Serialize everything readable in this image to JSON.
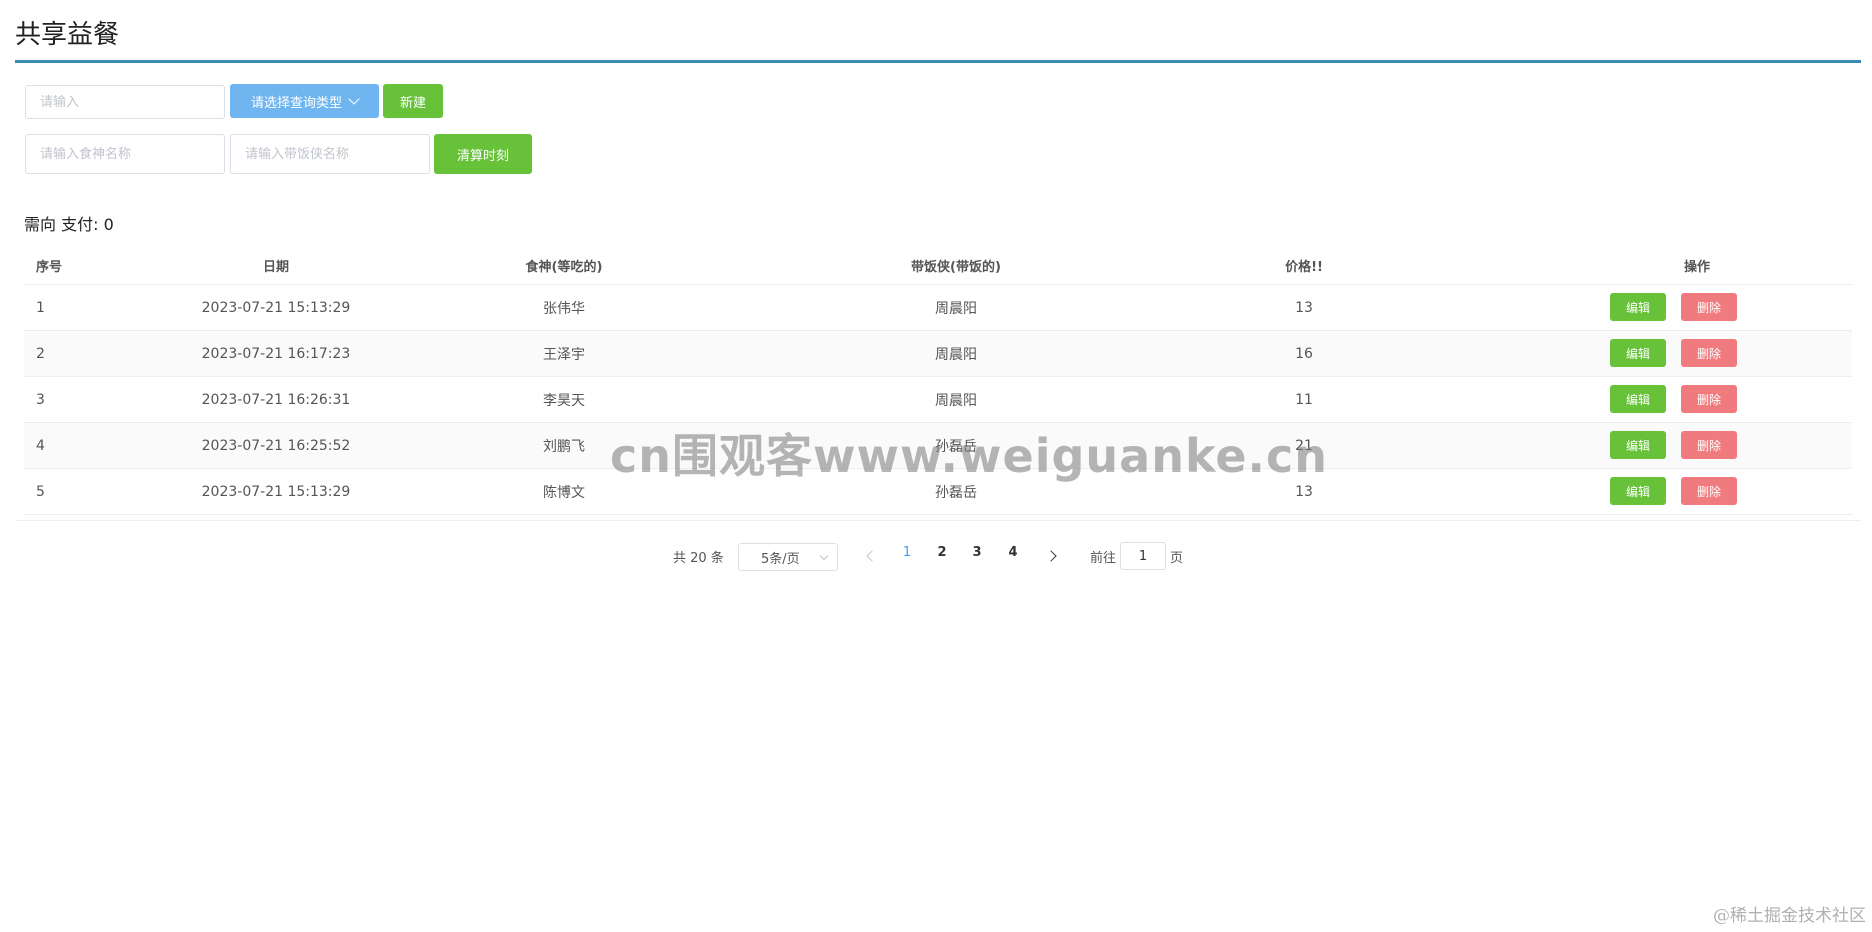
{
  "page_title": "共享益餐",
  "toolbar": {
    "search_placeholder": "请输入",
    "query_type_label": "请选择查询类型",
    "new_label": "新建",
    "eater_placeholder": "请输入食神名称",
    "carrier_placeholder": "请输入带饭侠名称",
    "settle_label": "清算时刻"
  },
  "summary": "需向 支付: 0",
  "table": {
    "headers": {
      "idx": "序号",
      "date": "日期",
      "eater": "食神(等吃的)",
      "carrier": "带饭侠(带饭的)",
      "price": "价格!!",
      "ops": "操作"
    },
    "edit_label": "编辑",
    "delete_label": "删除",
    "rows": [
      {
        "idx": "1",
        "date": "2023-07-21 15:13:29",
        "eater": "张伟华",
        "carrier": "周晨阳",
        "price": "13"
      },
      {
        "idx": "2",
        "date": "2023-07-21 16:17:23",
        "eater": "王泽宇",
        "carrier": "周晨阳",
        "price": "16"
      },
      {
        "idx": "3",
        "date": "2023-07-21 16:26:31",
        "eater": "李昊天",
        "carrier": "周晨阳",
        "price": "11"
      },
      {
        "idx": "4",
        "date": "2023-07-21 16:25:52",
        "eater": "刘鹏飞",
        "carrier": "孙磊岳",
        "price": "21"
      },
      {
        "idx": "5",
        "date": "2023-07-21 15:13:29",
        "eater": "陈博文",
        "carrier": "孙磊岳",
        "price": "13"
      }
    ]
  },
  "pagination": {
    "total_label": "共 20 条",
    "page_size_label": "5条/页",
    "pages": [
      "1",
      "2",
      "3",
      "4"
    ],
    "current_page": "1",
    "goto_label": "前往",
    "goto_value": "1",
    "page_suffix": "页"
  },
  "watermark": "cn围观客www.weiguanke.cn",
  "corner_mark": "@稀土掘金技术社区"
}
